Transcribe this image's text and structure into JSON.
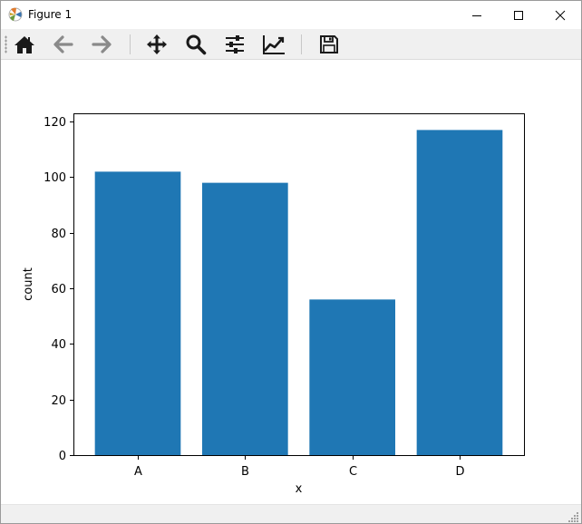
{
  "window": {
    "title": "Figure 1",
    "controls": {
      "minimize": "minimize-icon",
      "maximize": "maximize-icon",
      "close": "close-icon"
    }
  },
  "toolbar": {
    "buttons": [
      {
        "id": "home",
        "icon": "home-icon"
      },
      {
        "id": "back",
        "icon": "arrow-left-icon"
      },
      {
        "id": "forward",
        "icon": "arrow-right-icon"
      },
      {
        "id": "pan",
        "icon": "move-icon"
      },
      {
        "id": "zoom",
        "icon": "magnifier-icon"
      },
      {
        "id": "subplots",
        "icon": "sliders-icon"
      },
      {
        "id": "customize",
        "icon": "line-chart-icon"
      },
      {
        "id": "save",
        "icon": "floppy-disk-icon"
      }
    ]
  },
  "chart_data": {
    "type": "bar",
    "categories": [
      "A",
      "B",
      "C",
      "D"
    ],
    "values": [
      102,
      98,
      56,
      117
    ],
    "xlabel": "x",
    "ylabel": "count",
    "ylim": [
      0,
      123
    ],
    "yticks": [
      0,
      20,
      40,
      60,
      80,
      100,
      120
    ],
    "bar_color": "#1f77b4",
    "grid": false
  }
}
